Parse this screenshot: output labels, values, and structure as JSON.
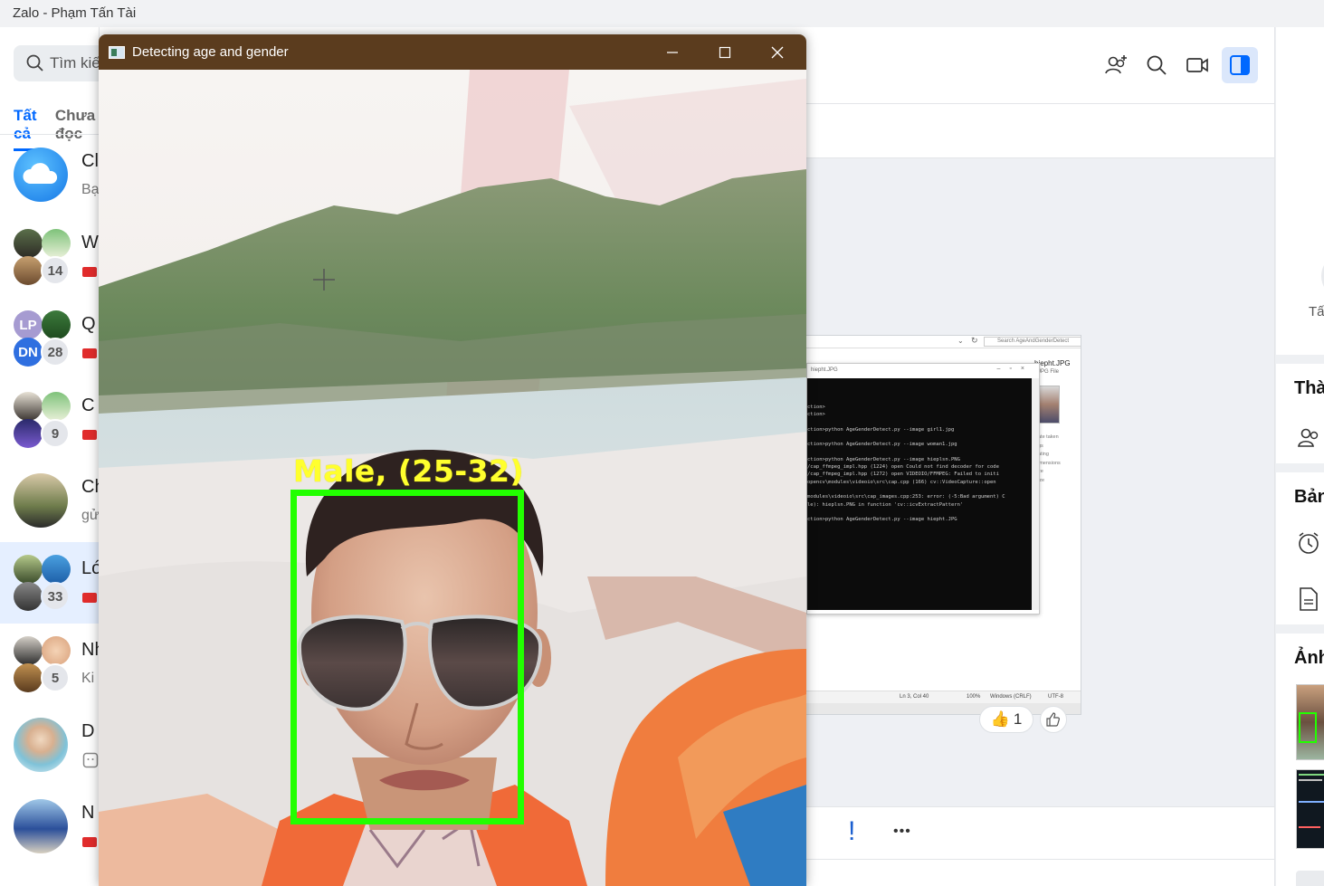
{
  "app": {
    "title": "Zalo - Phạm Tấn Tài"
  },
  "sidebar": {
    "search_placeholder": "Tìm kiếm",
    "tabs": {
      "all": "Tất cả",
      "other": "Chưa đọc"
    },
    "conversations": [
      {
        "name": "Cloud của tôi",
        "sub": "Bạn"
      },
      {
        "name": "W",
        "count": "14"
      },
      {
        "name": "Q",
        "count": "28",
        "initials_a": "LP",
        "initials_c": "DN"
      },
      {
        "name": "C",
        "count": "9"
      },
      {
        "name": "Ch",
        "sub": "gửi"
      },
      {
        "name": "Lớ",
        "count": "33"
      },
      {
        "name": "Nh",
        "count": "5",
        "sub": "Ki"
      },
      {
        "name": "D"
      },
      {
        "name": "N"
      }
    ]
  },
  "header": {
    "icons": [
      "add-user-icon",
      "search-icon",
      "video-call-icon",
      "sidebar-toggle-icon"
    ]
  },
  "chat": {
    "reactions": {
      "like_count": "1",
      "like_emoji": "👍"
    },
    "toolbar": {
      "exclaim": "!",
      "more": "•••"
    },
    "screenshot": {
      "search_text": "Search AgeAndGenderDetect",
      "file_name": "hiepht.JPG",
      "file_type": "JPG File",
      "inner_title": "hiepht.JPG",
      "status_ln": "Ln 3, Col 40",
      "status_zoom": "100%",
      "status_eol": "Windows (CRLF)",
      "status_enc": "UTF-8",
      "console_lines": [
        "ction>",
        "ction>",
        "ction>python AgeGenderDetect.py --image girl1.jpg",
        "ction>python AgeGenderDetect.py --image woman1.jpg",
        "ction>python AgeGenderDetect.py --image hieplsn.PNG",
        "/cap_ffmpeg_impl.hpp (1224) open Could not find decoder for code",
        "/cap_ffmpeg_impl.hpp (1272) open VIDEOIO/FFMPEG: Failed to initi",
        "opencv\\modules\\videoio\\src\\cap.cpp (166) cv::VideoCapture::open",
        "modules\\videoio\\src\\cap_images.cpp:253: error: (-5:Bad argument) C",
        "le): hieplsn.PNG in function 'cv::icvExtractPattern'",
        "ction>python AgeGenderDetect.py --image hiepht.JPG"
      ],
      "props": [
        "ate taken",
        "gs",
        "ating",
        "imensions",
        "ze",
        "ize"
      ]
    }
  },
  "right_panel": {
    "all_label": "Tất",
    "members_head": "Thà",
    "board_head": "Bản",
    "photos_head": "Ảnh"
  },
  "cv_window": {
    "title": "Detecting age and gender",
    "detection_label": "Male, (25-32)",
    "box_color": "#22ff00",
    "label_color": "#ffff2e",
    "titlebar_color": "#5b3c1e"
  }
}
